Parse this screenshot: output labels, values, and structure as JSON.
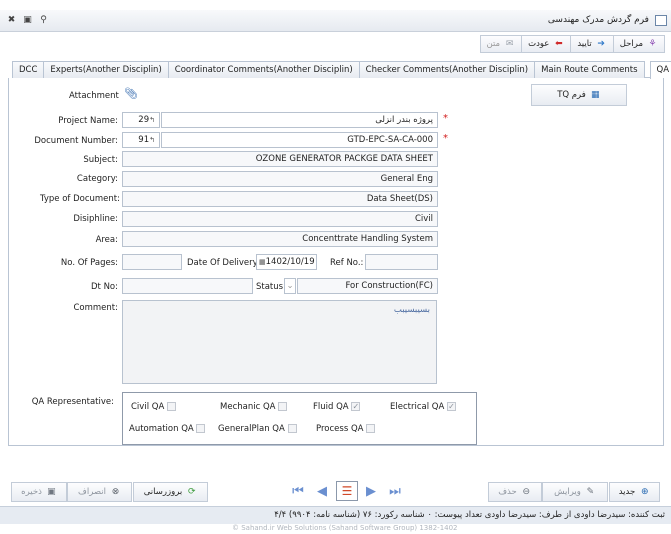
{
  "window": {
    "title": "فرم گردش مدرک مهندسی"
  },
  "toolbar": {
    "steps": "مراحل",
    "confirm": "تایید",
    "return": "عودت",
    "text": "متن"
  },
  "tabs": [
    "DCC",
    "Experts(Another Disciplin)",
    "Coordinator Comments(Another Disciplin)",
    "Checker Comments(Another Disciplin)",
    "Main Route Comments",
    "QA"
  ],
  "form": {
    "attachment_label": "Attachment",
    "tq_button": "فرم TQ",
    "project_name": {
      "label": "Project Name:",
      "code": "29",
      "value": "پروژه بندر انزلی"
    },
    "document_number": {
      "label": "Document Number:",
      "code": "91",
      "value": "GTD-EPC-SA-CA-000"
    },
    "subject": {
      "label": "Subject:",
      "value": "OZONE GENERATOR PACKGE DATA SHEET"
    },
    "category": {
      "label": "Category:",
      "value": "General Eng"
    },
    "type_of_document": {
      "label": "Type of Document:",
      "value": "Data Sheet(DS)"
    },
    "disipline": {
      "label": "Disiphline:",
      "value": "Civil"
    },
    "area": {
      "label": "Area:",
      "value": "Concenttrate Handling System"
    },
    "no_of_pages": {
      "label": "No. Of Pages:",
      "value": ""
    },
    "date_of_delivery": {
      "label": "Date Of Delivery:",
      "value": "1402/10/19"
    },
    "ref_no": {
      "label": "Ref No.:",
      "value": ""
    },
    "dt_no": {
      "label": "Dt No:",
      "value": ""
    },
    "status": {
      "label": "Status:",
      "value": "For Construction(FC)"
    },
    "comment": {
      "label": "Comment:",
      "value": "بسیبسیبب"
    },
    "qa_representative": {
      "label": "QA Representative:",
      "items": [
        {
          "label": "Civil QA",
          "checked": false
        },
        {
          "label": "Mechanic QA",
          "checked": false
        },
        {
          "label": "Fluid QA",
          "checked": true
        },
        {
          "label": "Electrical QA",
          "checked": true
        },
        {
          "label": "Automation QA",
          "checked": false
        },
        {
          "label": "GeneralPlan QA",
          "checked": false
        },
        {
          "label": "Process QA",
          "checked": false
        }
      ]
    }
  },
  "bottom": {
    "save": "ذخیره",
    "cancel": "انصراف",
    "update": "بروزرسانی",
    "delete": "حذف",
    "edit": "ویرایش",
    "new": "جدید"
  },
  "status_bar": "ثبت کننده: سیدرضا داودی   از طرف: سیدرضا داودی   تعداد پیوست: ۰   شناسه رکورد: ۷۶ (شناسه نامه: ۹۹۰۴)   ۴/۴",
  "copyright": "© Sahand.ir Web Solutions (Sahand Software Group) 1382-1402"
}
